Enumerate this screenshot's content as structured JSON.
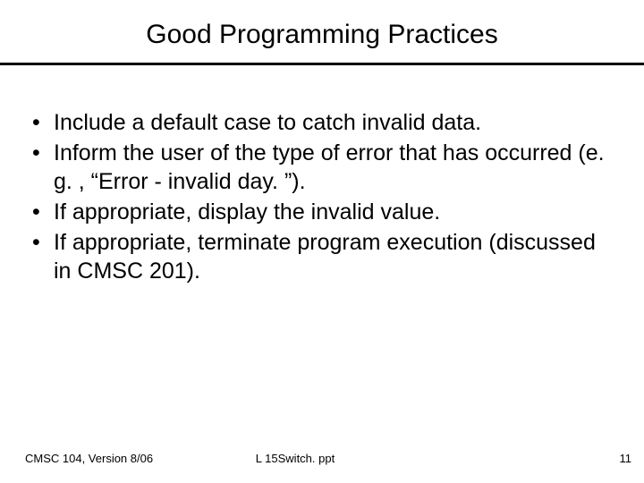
{
  "slide": {
    "title": "Good Programming Practices",
    "bullets": [
      "Include a default case to catch invalid data.",
      "Inform the user of the type of error that has occurred (e. g. , “Error - invalid day. ”).",
      "If appropriate, display the invalid value.",
      "If appropriate, terminate program execution (discussed in CMSC 201)."
    ],
    "footer": {
      "left": "CMSC 104, Version 8/06",
      "center": "L 15Switch. ppt",
      "right": "11"
    }
  }
}
